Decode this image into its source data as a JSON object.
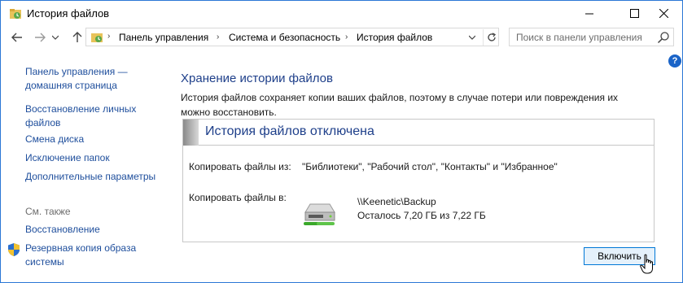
{
  "window": {
    "title": "История файлов"
  },
  "nav": {
    "back_icon": "arrow-left-icon",
    "forward_icon": "arrow-right-icon",
    "history_icon": "chevron-down-icon",
    "up_icon": "arrow-up-icon"
  },
  "address": {
    "crumbs": [
      "Панель управления",
      "Система и безопасность",
      "История файлов"
    ],
    "refresh_icon": "refresh-icon"
  },
  "search": {
    "placeholder": "Поиск в панели управления"
  },
  "sidebar": {
    "home_line1": "Панель управления —",
    "home_line2": "домашняя страница",
    "items": [
      {
        "line1": "Восстановление личных",
        "line2": "файлов"
      },
      {
        "line1": "Смена диска"
      },
      {
        "line1": "Исключение папок"
      },
      {
        "line1": "Дополнительные параметры"
      }
    ],
    "see_also": "См. также",
    "see_also_items": [
      {
        "line1": "Восстановление"
      },
      {
        "line1": "Резервная копия образа",
        "line2": "системы"
      }
    ]
  },
  "main": {
    "title": "Хранение истории файлов",
    "description": "История файлов сохраняет копии ваших файлов, поэтому в случае потери или повреждения их можно восстановить.",
    "status_title": "История файлов отключена",
    "copy_from_label": "Копировать файлы из:",
    "copy_from_value": "\"Библиотеки\", \"Рабочий стол\", \"Контакты\" и \"Избранное\"",
    "copy_to_label": "Копировать файлы в:",
    "drive_path": "\\\\Keenetic\\Backup",
    "drive_space": "Осталось 7,20 ГБ из 7,22 ГБ",
    "enable_button": "Включить"
  },
  "colors": {
    "link": "#1e4e9c",
    "heading": "#1e3f8a",
    "accent": "#0078d7"
  }
}
